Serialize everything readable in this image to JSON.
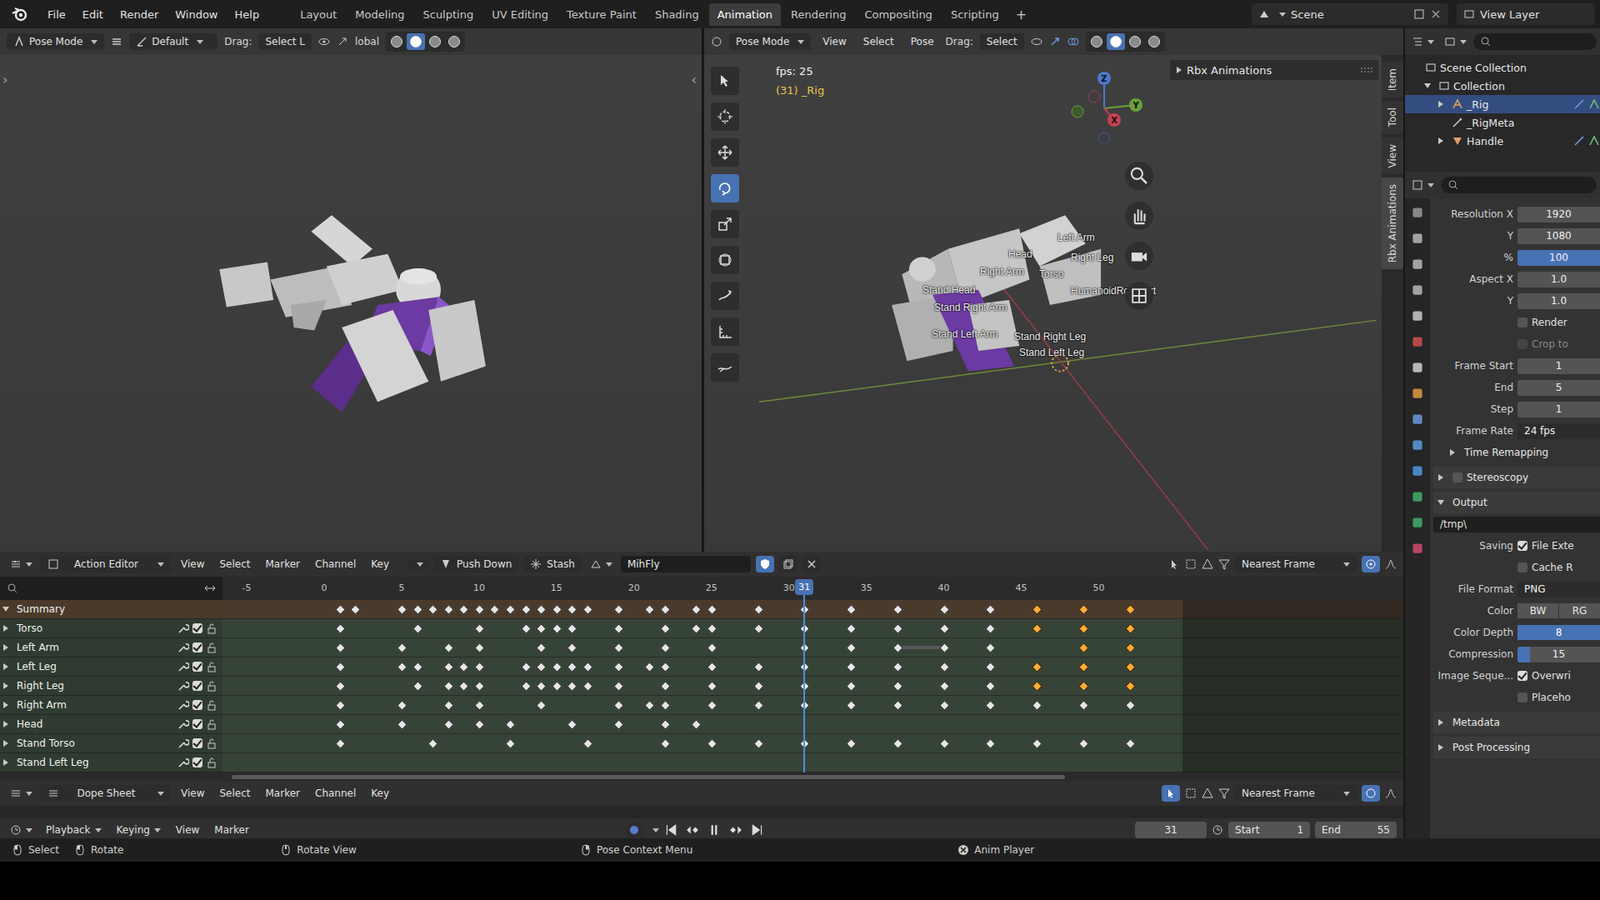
{
  "topbar": {
    "menus": [
      "File",
      "Edit",
      "Render",
      "Window",
      "Help"
    ],
    "workspaces": [
      {
        "label": "Layout",
        "selected": false
      },
      {
        "label": "Modeling",
        "selected": false
      },
      {
        "label": "Sculpting",
        "selected": false
      },
      {
        "label": "UV Editing",
        "selected": false
      },
      {
        "label": "Texture Paint",
        "selected": false
      },
      {
        "label": "Shading",
        "selected": false
      },
      {
        "label": "Animation",
        "selected": true
      },
      {
        "label": "Rendering",
        "selected": false
      },
      {
        "label": "Compositing",
        "selected": false
      },
      {
        "label": "Scripting",
        "selected": false
      }
    ],
    "add_tab": "+",
    "scene": "Scene",
    "view_layer": "View Layer"
  },
  "left_viewport": {
    "mode": "Pose Mode",
    "orientation": "Default",
    "drag_label": "Drag:",
    "drag_value": "Select L",
    "transform": "lobal",
    "shading": [
      {
        "selected": false
      },
      {
        "selected": true
      },
      {
        "selected": false
      },
      {
        "selected": false
      }
    ],
    "panel_arrows": [
      "›",
      "‹"
    ]
  },
  "right_viewport": {
    "mode": "Pose Mode",
    "menus": [
      "View",
      "Select",
      "Pose"
    ],
    "drag_label": "Drag:",
    "drag_value": "Select",
    "shading": [
      {
        "selected": false
      },
      {
        "selected": true
      },
      {
        "selected": false
      },
      {
        "selected": false
      }
    ],
    "overlay": {
      "fps": "fps: 25",
      "object": "(31) _Rig"
    },
    "tools": [
      {
        "kind": "select",
        "selected": false
      },
      {
        "kind": "cursor",
        "selected": false
      },
      {
        "kind": "move",
        "selected": false
      },
      {
        "kind": "rotate",
        "selected": true
      },
      {
        "kind": "scale",
        "selected": false
      },
      {
        "kind": "transform",
        "selected": false
      },
      {
        "kind": "annotate",
        "selected": false
      },
      {
        "kind": "measure",
        "selected": false
      },
      {
        "kind": "relax",
        "selected": false
      }
    ],
    "gizmo": {
      "z": "Z",
      "y": "Y",
      "x": "X"
    },
    "n_panel": {
      "title": "Rbx Animations",
      "expanded": false
    },
    "side_tabs": [
      {
        "label": "Item",
        "selected": false
      },
      {
        "label": "Tool",
        "selected": false
      },
      {
        "label": "View",
        "selected": false
      },
      {
        "label": "Rbx Animations",
        "selected": true
      }
    ],
    "bone_labels": [
      "Left Arm",
      "Right Leg",
      "Head",
      "Torso",
      "Right Arm",
      "Stand Head",
      "HumanoidRootPart",
      "Stand Right Arm",
      "Stand Left Arm",
      "Stand Right Leg",
      "Stand Left Leg"
    ]
  },
  "outliner": {
    "items": [
      {
        "label": "Scene Collection",
        "depth": 0,
        "kind": "scene",
        "selected": false,
        "expanded": true
      },
      {
        "label": "Collection",
        "depth": 1,
        "kind": "collection",
        "selected": false,
        "expanded": true
      },
      {
        "label": "_Rig",
        "depth": 2,
        "kind": "armature",
        "selected": true,
        "expanded": false
      },
      {
        "label": "_RigMeta",
        "depth": 2,
        "kind": "bone",
        "selected": false,
        "expanded": false
      },
      {
        "label": "Handle",
        "depth": 2,
        "kind": "mesh",
        "selected": false,
        "expanded": false
      }
    ]
  },
  "properties": {
    "rows": [
      {
        "kind": "field",
        "label": "Resolution X",
        "value": "1920"
      },
      {
        "kind": "field",
        "label": "Y",
        "value": "1080"
      },
      {
        "kind": "slider",
        "label": "%",
        "value": "100",
        "level": 1
      },
      {
        "kind": "field",
        "label": "Aspect X",
        "value": "1.0"
      },
      {
        "kind": "field",
        "label": "Y",
        "value": "1.0"
      },
      {
        "kind": "checkbox",
        "label": "Render",
        "checked": false,
        "disabled": false
      },
      {
        "kind": "checkbox",
        "label": "Crop to",
        "checked": false,
        "disabled": true
      },
      {
        "kind": "field",
        "label": "Frame Start",
        "value": "1"
      },
      {
        "kind": "field",
        "label": "End",
        "value": "5"
      },
      {
        "kind": "field",
        "label": "Step",
        "value": "1"
      },
      {
        "kind": "enum",
        "label": "Frame Rate",
        "value": "24 fps"
      },
      {
        "kind": "subpanel",
        "label": "Time Remapping",
        "expanded": false
      },
      {
        "kind": "panel",
        "label": "Stereoscopy",
        "expanded": false,
        "checked": false
      },
      {
        "kind": "panel",
        "label": "Output",
        "expanded": true
      },
      {
        "kind": "path",
        "value": "/tmp\\"
      },
      {
        "kind": "labeled-checkbox",
        "label": "Saving",
        "text": "File Exte",
        "checked": true
      },
      {
        "kind": "checkbox",
        "label": "Cache R",
        "checked": false,
        "disabled": false
      },
      {
        "kind": "enum",
        "label": "File Format",
        "value": "PNG"
      },
      {
        "kind": "toggle",
        "label": "Color",
        "options": [
          {
            "label": "BW",
            "selected": false
          },
          {
            "label": "RG",
            "selected": false
          }
        ]
      },
      {
        "kind": "toggle",
        "label": "Color Depth",
        "options": [
          {
            "label": "8",
            "selected": true
          }
        ]
      },
      {
        "kind": "slider",
        "label": "Compression",
        "value": "15",
        "level": 0.15
      },
      {
        "kind": "labeled-checkbox",
        "label": "Image Seque...",
        "text": "Overwri",
        "checked": true
      },
      {
        "kind": "checkbox",
        "label": "Placeho",
        "checked": false,
        "disabled": false
      },
      {
        "kind": "panel",
        "label": "Metadata",
        "expanded": false
      },
      {
        "kind": "panel",
        "label": "Post Processing",
        "expanded": false
      }
    ]
  },
  "action_editor": {
    "editor": "Action Editor",
    "menus": [
      "View",
      "Select",
      "Marker",
      "Channel",
      "Key"
    ],
    "push_down": "Push Down",
    "stash": "Stash",
    "action": "MihFly",
    "snapping": "Nearest Frame",
    "ruler": [
      "-5",
      "0",
      "5",
      "10",
      "15",
      "20",
      "25",
      "30",
      "35",
      "40",
      "45",
      "50"
    ],
    "current_frame": "31",
    "channels": [
      {
        "name": "Summary",
        "kind": "summary",
        "expanded": true,
        "checked": true,
        "keys": [
          1,
          2,
          5,
          6,
          7,
          8,
          9,
          10,
          11,
          12,
          13,
          14,
          15,
          16,
          17,
          19,
          21,
          22,
          24,
          25,
          28,
          31,
          34,
          37,
          40,
          43,
          46,
          49,
          52
        ],
        "selected_keys": [
          46,
          49,
          52
        ],
        "holds": []
      },
      {
        "name": "Torso",
        "kind": "group",
        "expanded": false,
        "checked": true,
        "keys": [
          1,
          6,
          10,
          13,
          14,
          15,
          16,
          19,
          22,
          24,
          25,
          28,
          31,
          34,
          37,
          40,
          43,
          46,
          49,
          52
        ],
        "selected_keys": [
          46,
          49,
          52
        ],
        "holds": []
      },
      {
        "name": "Left Arm",
        "kind": "group",
        "expanded": false,
        "checked": true,
        "keys": [
          1,
          5,
          8,
          10,
          14,
          16,
          19,
          22,
          25,
          31,
          34,
          37,
          40,
          43,
          49,
          52
        ],
        "selected_keys": [
          49,
          52
        ],
        "holds": [
          [
            37,
            40
          ]
        ]
      },
      {
        "name": "Left Leg",
        "kind": "group",
        "expanded": false,
        "checked": true,
        "keys": [
          1,
          5,
          6,
          8,
          9,
          10,
          13,
          14,
          15,
          16,
          17,
          19,
          21,
          22,
          25,
          28,
          31,
          34,
          37,
          40,
          43,
          46,
          49,
          52
        ],
        "selected_keys": [
          46,
          49,
          52
        ],
        "holds": []
      },
      {
        "name": "Right Leg",
        "kind": "group",
        "expanded": false,
        "checked": true,
        "keys": [
          1,
          6,
          8,
          9,
          10,
          13,
          14,
          15,
          16,
          17,
          19,
          22,
          25,
          28,
          31,
          34,
          37,
          40,
          43,
          46,
          49,
          52
        ],
        "selected_keys": [
          46,
          49,
          52
        ],
        "holds": []
      },
      {
        "name": "Right Arm",
        "kind": "group",
        "expanded": false,
        "checked": true,
        "keys": [
          1,
          5,
          8,
          10,
          14,
          19,
          21,
          22,
          25,
          28,
          31,
          34,
          37,
          40,
          43,
          46,
          49,
          52
        ],
        "selected_keys": [],
        "holds": []
      },
      {
        "name": "Head",
        "kind": "group",
        "expanded": false,
        "checked": true,
        "keys": [
          1,
          5,
          8,
          10,
          12,
          16,
          19,
          22,
          24
        ],
        "selected_keys": [],
        "holds": []
      },
      {
        "name": "Stand Torso",
        "kind": "group",
        "expanded": false,
        "checked": true,
        "keys": [
          1,
          7,
          12,
          17,
          22,
          25,
          28,
          31,
          34,
          37,
          40,
          43,
          46,
          49,
          52
        ],
        "selected_keys": [],
        "holds": []
      },
      {
        "name": "Stand Left Leg",
        "kind": "group",
        "expanded": false,
        "checked": true,
        "keys": [],
        "selected_keys": [],
        "holds": []
      }
    ]
  },
  "dope_sheet": {
    "editor": "Dope Sheet",
    "menus": [
      "View",
      "Select",
      "Marker",
      "Channel",
      "Key"
    ],
    "snapping": "Nearest Frame"
  },
  "timeline": {
    "menus": [
      {
        "label": "Playback",
        "dropdown": true
      },
      {
        "label": "Keying",
        "dropdown": true
      },
      {
        "label": "View",
        "dropdown": false
      },
      {
        "label": "Marker",
        "dropdown": false
      }
    ],
    "current": "31",
    "start_label": "Start",
    "start": "1",
    "end_label": "End",
    "end": "55",
    "playing": true
  },
  "status_bar": [
    {
      "label": "Select",
      "kind": "lmb"
    },
    {
      "label": "Rotate",
      "kind": "lmb-drag"
    },
    {
      "label": "Rotate View",
      "kind": "mmb"
    },
    {
      "label": "Pose Context Menu",
      "kind": "rmb"
    },
    {
      "label": "Anim Player",
      "kind": "cancel"
    }
  ]
}
